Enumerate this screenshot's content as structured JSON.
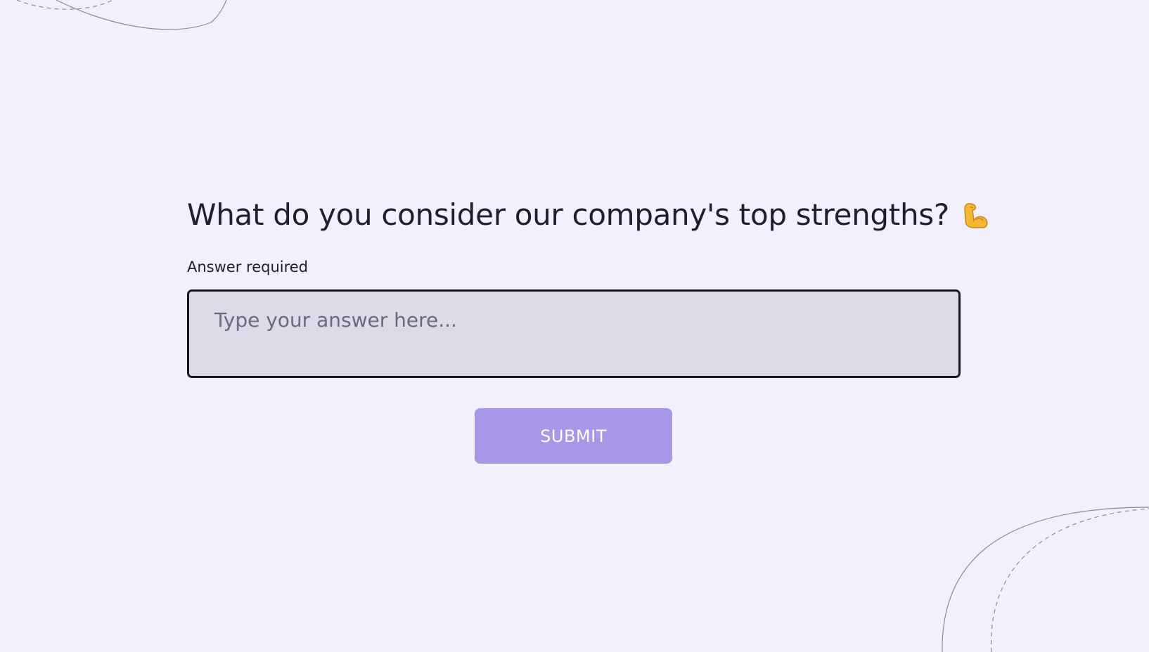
{
  "colors": {
    "background": "#f1f0fc",
    "text": "#1e1e2f",
    "label": "#1e1e2f",
    "field_bg": "#dcdbe8",
    "field_border": "#17171f",
    "placeholder": "#6b6a7c",
    "button_bg": "#a896e8",
    "button_text": "#ffffff",
    "decor_line": "#8c8a96"
  },
  "form": {
    "question": "What do you consider our company's top strengths?",
    "question_emoji_icon": "flexed-biceps-icon",
    "required_label": "Answer required",
    "answer": {
      "value": "",
      "placeholder": "Type your answer here..."
    },
    "submit_label": "SUBMIT"
  },
  "decorations": {
    "top_left": "curved-line-decoration",
    "bottom_right": "curved-line-decoration"
  }
}
